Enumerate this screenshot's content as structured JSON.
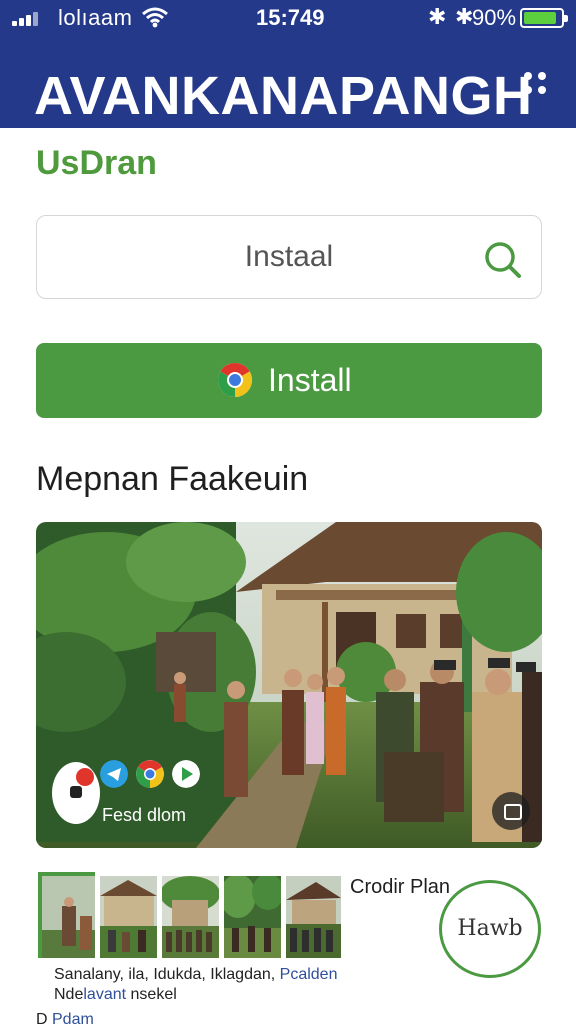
{
  "status_bar": {
    "carrier": "lolıaam",
    "time": "15:749",
    "battery_percent": "90%",
    "battery_level": 0.9,
    "icons": [
      "signal-icon",
      "wifi-icon",
      "bluetooth-icon",
      "bluetooth-icon",
      "battery-icon"
    ]
  },
  "header": {
    "title": "AVANKANAPANGH",
    "menu_icon": "grid-dots-icon"
  },
  "section_label": "UsDran",
  "search": {
    "value": "Instaal",
    "icon": "search-icon"
  },
  "install_button": {
    "label": "Install",
    "icon": "chrome-icon"
  },
  "feature_heading": "Mepnan Faakeuin",
  "hero": {
    "caption": "Fesd dlom",
    "app_icons": [
      "telegram-icon",
      "chrome-icon",
      "play-icon"
    ]
  },
  "gallery": {
    "credit_label": "Crodir Plan",
    "caption_line_1": [
      "Sanalany, ",
      "ila, ",
      "Idukda, ",
      "Iklagdan, "
    ],
    "caption_line_1_accent": "Pcalden",
    "caption_line_2": [
      "Nde",
      " ",
      "nsekel"
    ],
    "caption_line_2_accent": "lavant"
  },
  "fab": {
    "label": "Hawb"
  },
  "bottom": {
    "prefix": "D ",
    "accent": "Pdam"
  },
  "colors": {
    "header_bg": "#24398a",
    "accent_green": "#4b9a42",
    "label_green": "#4e9a3c",
    "battery_green": "#5ccf3f",
    "link_blue": "#2f4f9a"
  }
}
